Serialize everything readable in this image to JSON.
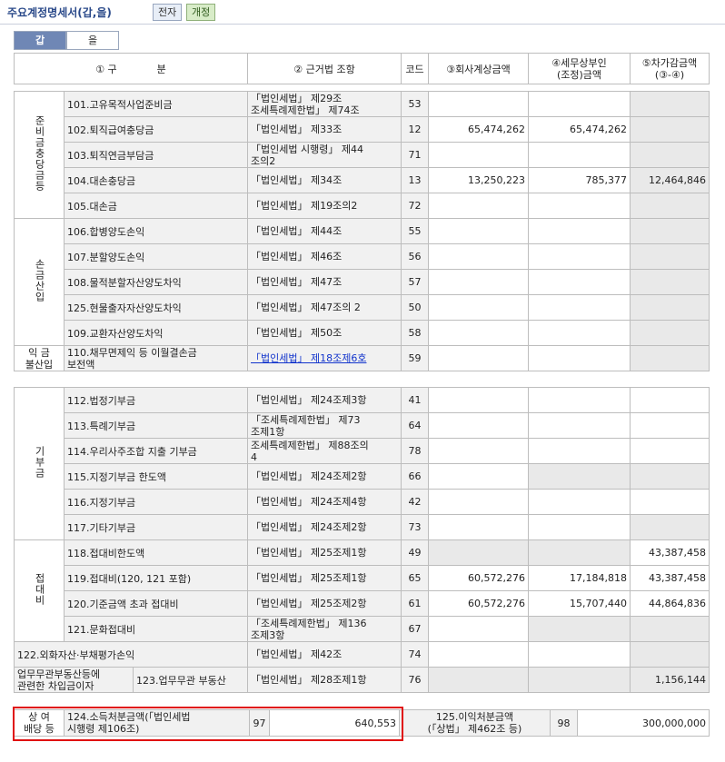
{
  "title": "주요계정명세서(갑,을)",
  "buttons": {
    "electronic": "전자",
    "revised": "개정"
  },
  "tabs": [
    "갑",
    "을"
  ],
  "header": {
    "col1": "① 구　　　　분",
    "col2": "② 근거법 조항",
    "col3": "코드",
    "col4": "③회사계상금액",
    "col5": "④세무상부인\n(조정)금액",
    "col6": "⑤차가감금액\n(③-④)"
  },
  "groups": {
    "reserve": "준비금충당금등",
    "loss": "손금산입",
    "income_exclusion": "익 금\n불산입",
    "donation": "기부금",
    "entertainment": "접대비",
    "bonus": "상 여\n배당 등"
  },
  "rows_reserve": [
    {
      "label": "101.고유목적사업준비금",
      "law": "「법인세법」 제29조\n조세특례제한법」 제74조",
      "code": "53",
      "col3": "",
      "col4": "",
      "col5": ""
    },
    {
      "label": "102.퇴직급여충당금",
      "law": "「법인세법」 제33조",
      "code": "12",
      "col3": "65,474,262",
      "col4": "65,474,262",
      "col5": ""
    },
    {
      "label": "103.퇴직연금부담금",
      "law": "「법인세법 시행령」 제44\n조의2",
      "code": "71",
      "col3": "",
      "col4": "",
      "col5": ""
    },
    {
      "label": "104.대손충당금",
      "law": "「법인세법」 제34조",
      "code": "13",
      "col3": "13,250,223",
      "col4": "785,377",
      "col5": "12,464,846"
    },
    {
      "label": "105.대손금",
      "law": "「법인세법」 제19조의2",
      "code": "72",
      "col3": "",
      "col4": "",
      "col5": ""
    }
  ],
  "rows_loss": [
    {
      "label": "106.합병양도손익",
      "law": "「법인세법」 제44조",
      "code": "55"
    },
    {
      "label": "107.분할양도손익",
      "law": "「법인세법」 제46조",
      "code": "56"
    },
    {
      "label": "108.물적분할자산양도차익",
      "law": "「법인세법」 제47조",
      "code": "57"
    },
    {
      "label": "125.현물출자자산양도차익",
      "law": "「법인세법」 제47조의 2",
      "code": "50"
    },
    {
      "label": "109.교환자산양도차익",
      "law": "「법인세법」 제50조",
      "code": "58"
    }
  ],
  "row_exclusion": {
    "label": "110.채무면제익 등 이월결손금\n보전액",
    "law": "「법인세법」 제18조제6호",
    "code": "59"
  },
  "rows_donation": [
    {
      "label": "112.법정기부금",
      "law": "「법인세법」 제24조제3항",
      "code": "41"
    },
    {
      "label": "113.특례기부금",
      "law": "「조세특례제한법」 제73\n조제1항",
      "code": "64"
    },
    {
      "label": "114.우리사주조합 지출 기부금",
      "law": "조세특례제한법」 제88조의\n4",
      "code": "78"
    },
    {
      "label": "115.지정기부금 한도액",
      "law": "「법인세법」 제24조제2항",
      "code": "66"
    },
    {
      "label": "116.지정기부금",
      "law": "「법인세법」 제24조제4항",
      "code": "42"
    },
    {
      "label": "117.기타기부금",
      "law": "「법인세법」 제24조제2항",
      "code": "73"
    }
  ],
  "rows_entertainment": [
    {
      "label": "118.접대비한도액",
      "law": "「법인세법」 제25조제1항",
      "code": "49",
      "col3": "",
      "col4": "",
      "col5": "43,387,458"
    },
    {
      "label": "119.접대비(120, 121 포함)",
      "law": "「법인세법」 제25조제1항",
      "code": "65",
      "col3": "60,572,276",
      "col4": "17,184,818",
      "col5": "43,387,458"
    },
    {
      "label": "120.기준금액 초과 접대비",
      "law": "「법인세법」 제25조제2항",
      "code": "61",
      "col3": "60,572,276",
      "col4": "15,707,440",
      "col5": "44,864,836"
    },
    {
      "label": "121.문화접대비",
      "law": "「조세특례제한법」 제136\n조제3항",
      "code": "67",
      "col3": "",
      "col4": "",
      "col5": ""
    }
  ],
  "row_122": {
    "label": "122.외화자산·부채평가손익",
    "law": "「법인세법」 제42조",
    "code": "74"
  },
  "row_123": {
    "group": "업무무관부동산등에\n관련한 차입금이자",
    "label": "123.업무무관 부동산",
    "law": "「법인세법」 제28조제1항",
    "code": "76",
    "col5": "1,156,144"
  },
  "row_bonus": {
    "label124": "124.소득처분금액(「법인세법\n시행령 제106조)",
    "code124": "97",
    "value124": "640,553",
    "label125": "125.이익처분금액\n(「상법」 제462조 등)",
    "code125": "98",
    "value125": "300,000,000"
  }
}
